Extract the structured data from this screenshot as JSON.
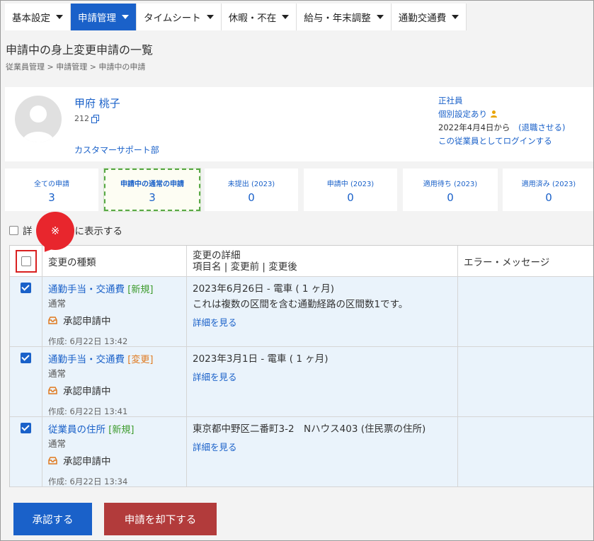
{
  "nav": [
    {
      "label": "基本設定",
      "active": false
    },
    {
      "label": "申請管理",
      "active": true
    },
    {
      "label": "タイムシート",
      "active": false
    },
    {
      "label": "休暇・不在",
      "active": false
    },
    {
      "label": "給与・年末調整",
      "active": false
    },
    {
      "label": "通勤交通費",
      "active": false
    }
  ],
  "page_title": "申請中の身上変更申請の一覧",
  "breadcrumb": "従業員管理 > 申請管理 > 申請中の申請",
  "employee": {
    "name": "甲府 桃子",
    "id": "212",
    "department": "カスタマーサポート部",
    "employment_type": "正社員",
    "personal_setting": "個別設定あり",
    "start_date": "2022年4月4日から",
    "retire_link": "(退職させる)",
    "login_link": "この従業員としてログインする"
  },
  "tabs": [
    {
      "label": "全ての申請",
      "count": "3"
    },
    {
      "label": "申請中の通常の申請",
      "count": "3"
    },
    {
      "label": "未提出 (2023)",
      "count": "0"
    },
    {
      "label": "申請中 (2023)",
      "count": "0"
    },
    {
      "label": "適用待ち (2023)",
      "count": "0"
    },
    {
      "label": "適用済み (2023)",
      "count": "0"
    }
  ],
  "detail_toggle": {
    "left": "詳",
    "right": "に表示する"
  },
  "callout_mark": "※",
  "table": {
    "headers": {
      "type": "変更の種類",
      "detail_1": "変更の詳細",
      "detail_2": "項目名 | 変更前 | 変更後",
      "error": "エラー・メッセージ"
    },
    "rows": [
      {
        "type": "通勤手当・交通費",
        "tag": "[新規]",
        "sub": "通常",
        "status": "承認申請中",
        "created": "作成: 6月22日 13:42",
        "detail_1": "2023年6月26日 - 電車 ( 1 ヶ月)",
        "detail_2": "これは複数の区間を含む通勤経路の区間数1です。",
        "link": "詳細を見る"
      },
      {
        "type": "通勤手当・交通費",
        "tag": "[変更]",
        "sub": "通常",
        "status": "承認申請中",
        "created": "作成: 6月22日 13:41",
        "detail_1": "2023年3月1日 - 電車 ( 1 ヶ月)",
        "link": "詳細を見る"
      },
      {
        "type": "従業員の住所",
        "tag": "[新規]",
        "sub": "通常",
        "status": "承認申請中",
        "created": "作成: 6月22日 13:34",
        "detail_1": "東京都中野区二番町3-2　Nハウス403 (住民票の住所)",
        "link": "詳細を見る"
      }
    ]
  },
  "buttons": {
    "approve": "承認する",
    "reject": "申請を却下する"
  },
  "colors": {
    "accent": "#1a61c9",
    "reject": "#b23b3b",
    "callout": "#e8262d",
    "tag_new": "#3a9a2a",
    "tag_change": "#e07a20"
  }
}
